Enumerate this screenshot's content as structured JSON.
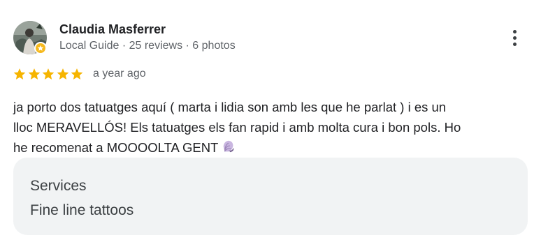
{
  "reviewer": {
    "name": "Claudia Masferrer",
    "meta": "Local Guide · 25 reviews · 6 photos",
    "avatar_icon": "user-photo",
    "badge_icon": "local-guide-star-icon",
    "badge_color": "#f6b91d"
  },
  "review": {
    "rating": 5,
    "rating_max": 5,
    "star_color": "#f6b400",
    "time": "a year ago",
    "text_lines": [
      "ja porto dos tatuatges aquí ( marta i lidia son amb les que he parlat ) i es un",
      "lloc MERAVELLÓS! Els tatuatges els fan rapid i amb molta cura i bon pols. Ho",
      "he recomenat a MOOOOLTA GENT"
    ],
    "emoji_icon": "spiral-shell-emoji"
  },
  "menu": {
    "icon": "more-vertical-icon"
  },
  "services": {
    "label": "Services",
    "value": "Fine line tattoos"
  }
}
